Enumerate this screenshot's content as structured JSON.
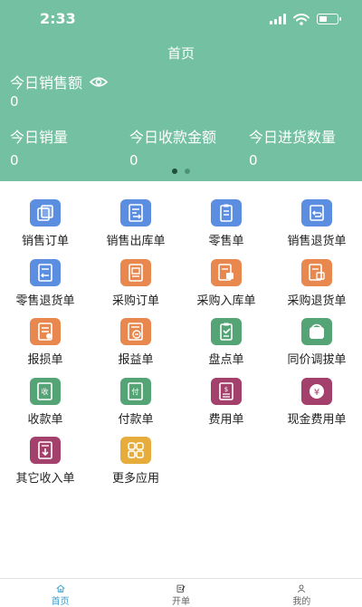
{
  "status_bar": {
    "time": "2:33"
  },
  "header": {
    "title": "首页",
    "sales_amount": {
      "label": "今日销售额",
      "value": "0"
    },
    "stats": [
      {
        "label": "今日销量",
        "value": "0"
      },
      {
        "label": "今日收款金额",
        "value": "0"
      },
      {
        "label": "今日进货数量",
        "value": "0"
      }
    ]
  },
  "carousel": {
    "page_count": 2,
    "active_index": 0
  },
  "apps": [
    {
      "label": "销售订单",
      "icon": "sales-order-icon",
      "color": "#5b8de0"
    },
    {
      "label": "销售出库单",
      "icon": "sales-outbound-icon",
      "color": "#5b8de0"
    },
    {
      "label": "零售单",
      "icon": "retail-clipboard-icon",
      "color": "#5b8de0"
    },
    {
      "label": "销售退货单",
      "icon": "sales-return-icon",
      "color": "#5b8de0"
    },
    {
      "label": "零售退货单",
      "icon": "retail-return-icon",
      "color": "#5b8de0"
    },
    {
      "label": "采购订单",
      "icon": "purchase-order-icon",
      "color": "#e8884f"
    },
    {
      "label": "采购入库单",
      "icon": "purchase-inbound-icon",
      "color": "#e8884f"
    },
    {
      "label": "采购退货单",
      "icon": "purchase-return-icon",
      "color": "#e8884f"
    },
    {
      "label": "报损单",
      "icon": "loss-report-icon",
      "color": "#e8884f"
    },
    {
      "label": "报益单",
      "icon": "gain-report-icon",
      "color": "#e8884f"
    },
    {
      "label": "盘点单",
      "icon": "stocktake-icon",
      "color": "#55a476"
    },
    {
      "label": "同价调拔单",
      "icon": "transfer-icon",
      "color": "#55a476"
    },
    {
      "label": "收款单",
      "icon": "receipt-icon",
      "color": "#55a476"
    },
    {
      "label": "付款单",
      "icon": "payment-icon",
      "color": "#55a476"
    },
    {
      "label": "费用单",
      "icon": "expense-icon",
      "color": "#a3406b"
    },
    {
      "label": "现金费用单",
      "icon": "cash-expense-icon",
      "color": "#a3406b"
    },
    {
      "label": "其它收入单",
      "icon": "other-income-icon",
      "color": "#a3406b"
    },
    {
      "label": "更多应用",
      "icon": "more-apps-icon",
      "color": "#e6ac3c"
    }
  ],
  "tabbar": [
    {
      "label": "首页",
      "icon": "home-icon"
    },
    {
      "label": "开单",
      "icon": "edit-doc-icon"
    },
    {
      "label": "我的",
      "icon": "profile-icon"
    }
  ],
  "colors": {
    "header_bg": "#74c0a3",
    "tab_active": "#3b9fcf"
  }
}
